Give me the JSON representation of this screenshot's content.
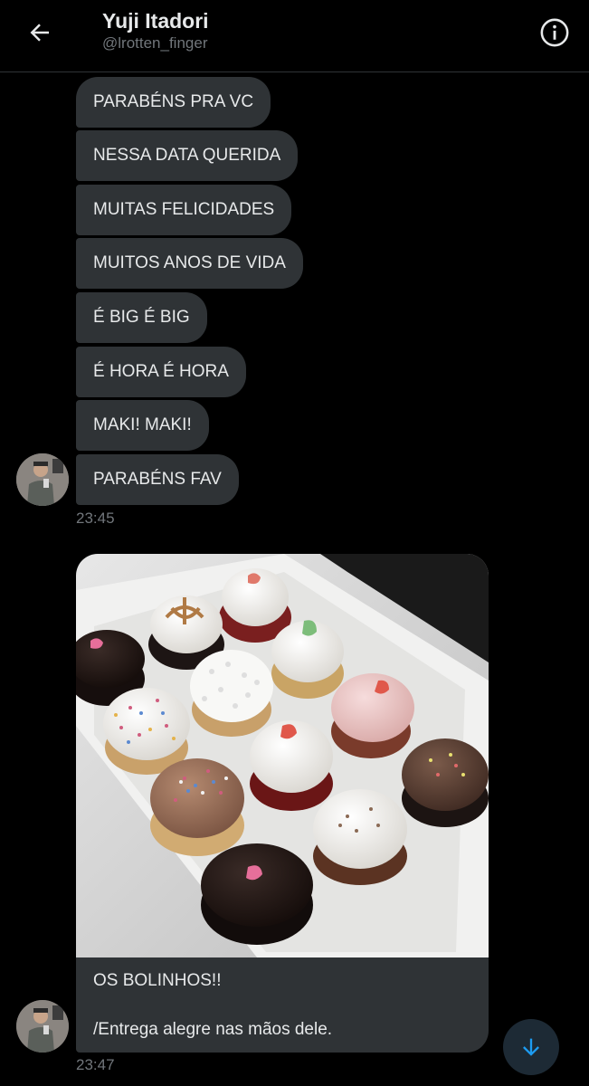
{
  "header": {
    "name": "Yuji Itadori",
    "handle": "@lrotten_finger",
    "back_icon": "arrow-left-icon",
    "info_icon": "info-icon"
  },
  "messages": [
    {
      "text": "PARABÉNS PRA VC"
    },
    {
      "text": "NESSA DATA QUERIDA"
    },
    {
      "text": "MUITAS FELICIDADES"
    },
    {
      "text": "MUITOS ANOS DE VIDA"
    },
    {
      "text": "É BIG É BIG"
    },
    {
      "text": "É HORA É HORA"
    },
    {
      "text": "MAKI! MAKI!"
    },
    {
      "text": "PARABÉNS FAV"
    }
  ],
  "group1": {
    "time": "23:45"
  },
  "media_message": {
    "image_alt": "box of cupcakes",
    "caption": "OS BOLINHOS!!\n\n/Entrega alegre nas mãos dele.",
    "time": "23:47"
  },
  "fab": {
    "icon": "arrow-down-icon"
  },
  "colors": {
    "background": "#000000",
    "bubble": "#2f3336",
    "text": "#e7e9ea",
    "muted": "#71767b",
    "accent": "#1d9bf0"
  }
}
